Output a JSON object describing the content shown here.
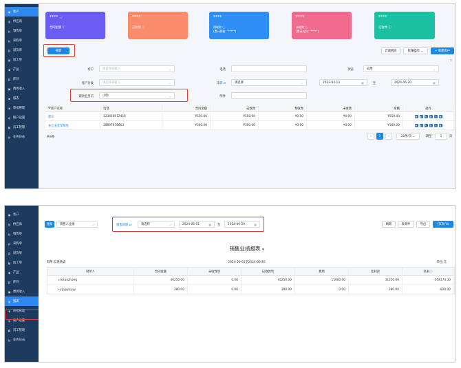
{
  "sidebar1": [
    "客户",
    "供应商",
    "销售单",
    "采购单",
    "退货单",
    "加工单",
    "产品",
    "库存",
    "费用收入",
    "报表",
    "审批管理",
    "账户设置",
    "员工管理",
    "业务日志"
  ],
  "sidebar2": [
    "客户",
    "供应商",
    "销售单",
    "采购单",
    "退货单",
    "加工单",
    "产品",
    "库存",
    "费用收入",
    "报表",
    "审批管理",
    "账户设置",
    "员工管理",
    "业务日志"
  ],
  "p1": {
    "cards": [
      {
        "stars": "****",
        "label": "合同金额",
        "color": "#6a5df2"
      },
      {
        "stars": "****",
        "label": "已收款",
        "color": "#fa8c6b"
      },
      {
        "stars": "****",
        "label": "预收款",
        "sub": "(累计预收：*****)",
        "color": "#2f8ef4"
      },
      {
        "stars": "****",
        "label": "未收款",
        "sub": "(累计欠款：*****)",
        "color": "#f06b8e"
      },
      {
        "stars": "****",
        "label": "已收款",
        "color": "#1cc1a3"
      }
    ],
    "search_btn": "搜索",
    "btn_cloud": "云端回收",
    "btn_batch": "批量操作",
    "btn_new": "+ 新建客户",
    "f_customer_label": "客户",
    "f_customer_ph": "请选择或输入",
    "f_phone_label": "电话",
    "f_status_label": "状态",
    "f_status_val": "启用",
    "f_category_label": "客户分类",
    "f_category_ph": "请选择或输入",
    "f_date_label": "日期",
    "f_date_sel": "请选择",
    "f_date_from": "2023-04-13",
    "f_date_to_label": "至",
    "f_date_to": "2024-06-20",
    "f_owner_label": "跟进业务员",
    "f_owner_val": "小明",
    "f_note_label": "附件",
    "table_headers": [
      "客户名称",
      "电话",
      "合同金额",
      "已收款",
      "预收款",
      "未收款",
      "余额",
      "操作"
    ],
    "rows": [
      [
        "建三",
        "123456672456",
        "¥550.00",
        "¥550.00",
        "¥0.00",
        "¥0.00",
        "¥550.00"
      ],
      [
        "长江五金贸易生",
        "18897678863",
        "¥300.00",
        "¥300.00",
        "¥0.00",
        "¥0.00",
        "¥300.00"
      ]
    ],
    "total": "共3条",
    "page": "1",
    "page_size": "20条/页",
    "goto_label": "跳至",
    "goto_val": "1",
    "goto_unit": "页"
  },
  "p2": {
    "search_btn": "搜索",
    "type_select": "销售人业绩",
    "date_type": "销售日期",
    "date_sel": "请选择",
    "date_from": "2024-06-01",
    "date_to_label": "至",
    "date_to": "2024-06-20",
    "btn_refresh": "刷新",
    "btn_mail": "发邮件",
    "btn_export": "导出",
    "btn_print": "打印(F8)",
    "report_title": "销售业绩报表",
    "company": "制单:云速商城",
    "period": "2024-06-01至2024-06-20",
    "unit": "单位:元",
    "headers": [
      "制单人",
      "合同金额",
      "未收款项",
      "已收款项",
      "费用",
      "毛利润",
      "毛利"
    ],
    "rows": [
      [
        "mkaozhang",
        "46250.00",
        "0.00",
        "46250.00",
        "15000.00",
        "31250.00",
        "-558174.30"
      ],
      [
        "yyyyyyyyy",
        "280.00",
        "0.00",
        "280.00",
        "0.00",
        "280.00",
        "-820.00"
      ]
    ]
  }
}
